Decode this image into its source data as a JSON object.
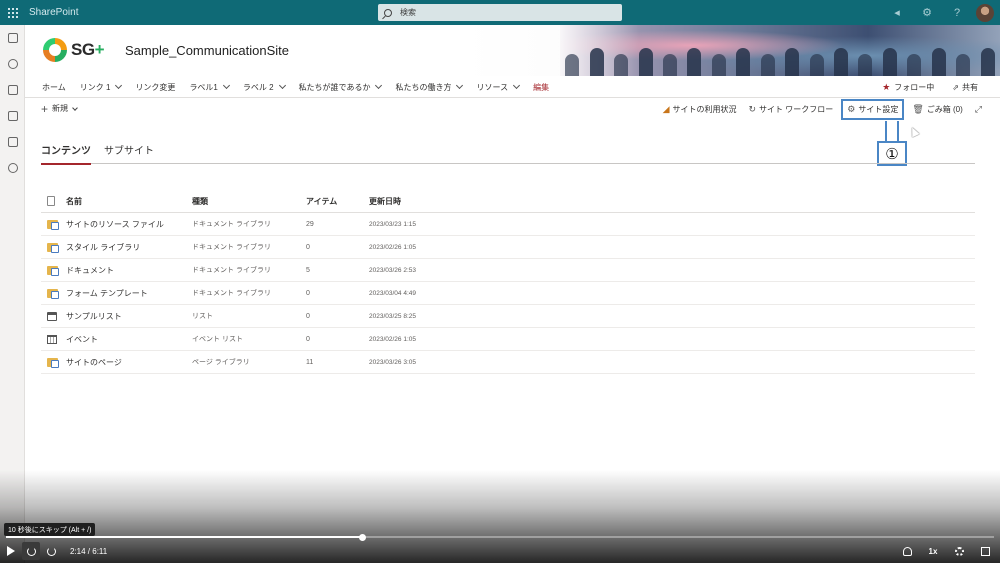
{
  "suite": {
    "app_name": "SharePoint",
    "search_placeholder": "検索"
  },
  "header": {
    "logo_text": "SG",
    "logo_plus": "+",
    "site_title": "Sample_CommunicationSite"
  },
  "nav": {
    "items": [
      {
        "label": "ホーム",
        "chevron": false
      },
      {
        "label": "リンク 1",
        "chevron": true
      },
      {
        "label": "リンク変更",
        "chevron": false
      },
      {
        "label": "ラベル1",
        "chevron": true
      },
      {
        "label": "ラベル 2",
        "chevron": true
      },
      {
        "label": "私たちが誰であるか",
        "chevron": true
      },
      {
        "label": "私たちの働き方",
        "chevron": true
      },
      {
        "label": "リソース",
        "chevron": true
      }
    ],
    "edit_label": "編集",
    "follow_label": "フォロー中",
    "share_label": "共有"
  },
  "command_bar": {
    "new_label": "新規",
    "site_usage": "サイトの利用状況",
    "site_workflow": "サイト ワークフロー",
    "site_settings": "サイト設定",
    "recycle_bin": "ごみ箱 (0)"
  },
  "callout": {
    "label": "①"
  },
  "tabs": [
    {
      "label": "コンテンツ",
      "active": true
    },
    {
      "label": "サブサイト",
      "active": false
    }
  ],
  "table": {
    "headers": {
      "name": "名前",
      "type": "種類",
      "items": "アイテム",
      "modified": "更新日時"
    },
    "rows": [
      {
        "icon": "library-icon",
        "name": "サイトのリソース ファイル",
        "type": "ドキュメント ライブラリ",
        "items": "29",
        "modified": "2023/03/23 1:15"
      },
      {
        "icon": "library-icon",
        "name": "スタイル ライブラリ",
        "type": "ドキュメント ライブラリ",
        "items": "0",
        "modified": "2023/02/26 1:05"
      },
      {
        "icon": "library-icon",
        "name": "ドキュメント",
        "type": "ドキュメント ライブラリ",
        "items": "5",
        "modified": "2023/03/26 2:53"
      },
      {
        "icon": "library-icon",
        "name": "フォーム テンプレート",
        "type": "ドキュメント ライブラリ",
        "items": "0",
        "modified": "2023/03/04 4:49"
      },
      {
        "icon": "list-icon",
        "name": "サンプルリスト",
        "type": "リスト",
        "items": "0",
        "modified": "2023/03/25 8:25"
      },
      {
        "icon": "calendar-icon",
        "name": "イベント",
        "type": "イベント リスト",
        "items": "0",
        "modified": "2023/02/26 1:05"
      },
      {
        "icon": "library-icon",
        "name": "サイトのページ",
        "type": "ページ ライブラリ",
        "items": "11",
        "modified": "2023/03/26 3:05"
      }
    ]
  },
  "player": {
    "tooltip": "10 秒後にスキップ (Alt + /)",
    "time": "2:14 / 6:11",
    "progress": 0.3612,
    "speed": "1x"
  }
}
